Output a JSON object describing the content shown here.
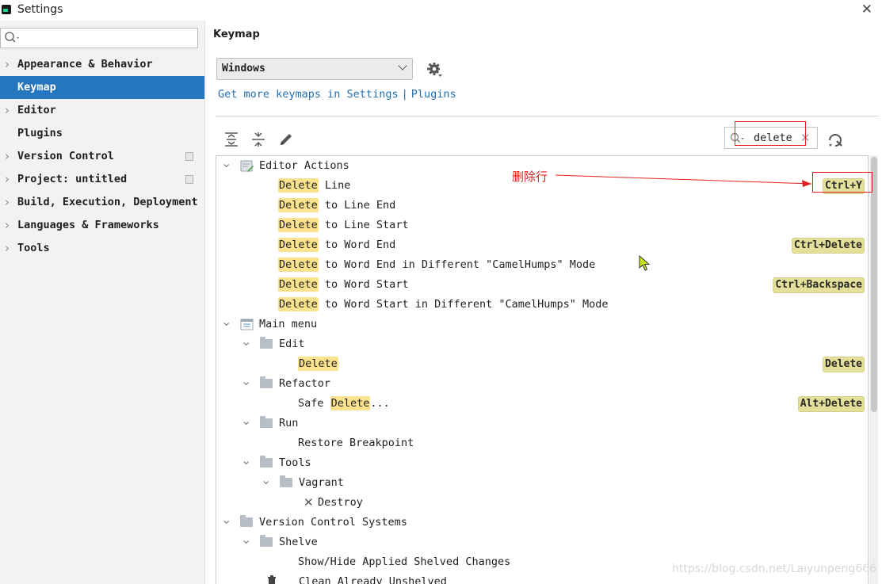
{
  "window": {
    "title": "Settings"
  },
  "sidebar": {
    "search_placeholder": "",
    "items": [
      {
        "label": "Appearance & Behavior",
        "expandable": true
      },
      {
        "label": "Keymap",
        "selected": true
      },
      {
        "label": "Editor",
        "expandable": true
      },
      {
        "label": "Plugins"
      },
      {
        "label": "Version Control",
        "expandable": true,
        "project_icon": true
      },
      {
        "label": "Project: untitled",
        "expandable": true,
        "project_icon": true
      },
      {
        "label": "Build, Execution, Deployment",
        "expandable": true
      },
      {
        "label": "Languages & Frameworks",
        "expandable": true
      },
      {
        "label": "Tools",
        "expandable": true
      }
    ]
  },
  "main": {
    "title": "Keymap",
    "keymap_value": "Windows",
    "link_get_more": "Get more keymaps in Settings",
    "link_sep": "|",
    "link_plugins": "Plugins",
    "search_value": "delete"
  },
  "tree": [
    {
      "indent": 0,
      "toggle": "open",
      "icon": "editor-actions",
      "parts": [
        {
          "t": "Editor Actions"
        }
      ]
    },
    {
      "indent": 2,
      "parts": [
        {
          "t": "Delete",
          "hl": true
        },
        {
          "t": " Line"
        }
      ],
      "shortcut": "Ctrl+Y"
    },
    {
      "indent": 2,
      "parts": [
        {
          "t": "Delete",
          "hl": true
        },
        {
          "t": " to Line End"
        }
      ]
    },
    {
      "indent": 2,
      "parts": [
        {
          "t": "Delete",
          "hl": true
        },
        {
          "t": " to Line Start"
        }
      ]
    },
    {
      "indent": 2,
      "parts": [
        {
          "t": "Delete",
          "hl": true
        },
        {
          "t": " to Word End"
        }
      ],
      "shortcut": "Ctrl+Delete"
    },
    {
      "indent": 2,
      "parts": [
        {
          "t": "Delete",
          "hl": true
        },
        {
          "t": " to Word End in Different \"CamelHumps\" Mode"
        }
      ]
    },
    {
      "indent": 2,
      "parts": [
        {
          "t": "Delete",
          "hl": true
        },
        {
          "t": " to Word Start"
        }
      ],
      "shortcut": "Ctrl+Backspace"
    },
    {
      "indent": 2,
      "parts": [
        {
          "t": "Delete",
          "hl": true
        },
        {
          "t": " to Word Start in Different \"CamelHumps\" Mode"
        }
      ]
    },
    {
      "indent": 0,
      "toggle": "open",
      "icon": "main-menu",
      "parts": [
        {
          "t": "Main menu"
        }
      ]
    },
    {
      "indent": 1,
      "toggle": "open",
      "icon": "folder",
      "parts": [
        {
          "t": "Edit"
        }
      ]
    },
    {
      "indent": 3,
      "parts": [
        {
          "t": "Delete",
          "hl": true
        }
      ],
      "shortcut": "Delete"
    },
    {
      "indent": 1,
      "toggle": "open",
      "icon": "folder",
      "parts": [
        {
          "t": "Refactor"
        }
      ]
    },
    {
      "indent": 3,
      "parts": [
        {
          "t": "Safe "
        },
        {
          "t": "Delete",
          "hl": true
        },
        {
          "t": "..."
        }
      ],
      "shortcut": "Alt+Delete"
    },
    {
      "indent": 1,
      "toggle": "open",
      "icon": "folder",
      "parts": [
        {
          "t": "Run"
        }
      ]
    },
    {
      "indent": 3,
      "parts": [
        {
          "t": "Restore Breakpoint"
        }
      ]
    },
    {
      "indent": 1,
      "toggle": "open",
      "icon": "folder",
      "parts": [
        {
          "t": "Tools"
        }
      ]
    },
    {
      "indent": 2,
      "toggle": "open",
      "icon": "folder",
      "parts": [
        {
          "t": "Vagrant"
        }
      ]
    },
    {
      "indent": 4,
      "icon": "cross",
      "parts": [
        {
          "t": "Destroy"
        }
      ]
    },
    {
      "indent": 0,
      "toggle": "open",
      "icon": "folder",
      "parts": [
        {
          "t": "Version Control Systems"
        }
      ]
    },
    {
      "indent": 1,
      "toggle": "open",
      "icon": "folder",
      "parts": [
        {
          "t": "Shelve"
        }
      ]
    },
    {
      "indent": 3,
      "parts": [
        {
          "t": "Show/Hide Applied Shelved Changes"
        }
      ]
    },
    {
      "indent": 3,
      "icon": "trash",
      "parts": [
        {
          "t": "Clean Already Unshelved"
        }
      ]
    }
  ],
  "annotation": {
    "label": "删除行"
  },
  "watermark": "https://blog.csdn.net/Laiyunpeng666",
  "colors": {
    "selection": "#2675bf",
    "highlight": "#fbe28e",
    "shortcut_bg": "#e4df9a",
    "link": "#2470b3",
    "annotation": "#e02020"
  }
}
